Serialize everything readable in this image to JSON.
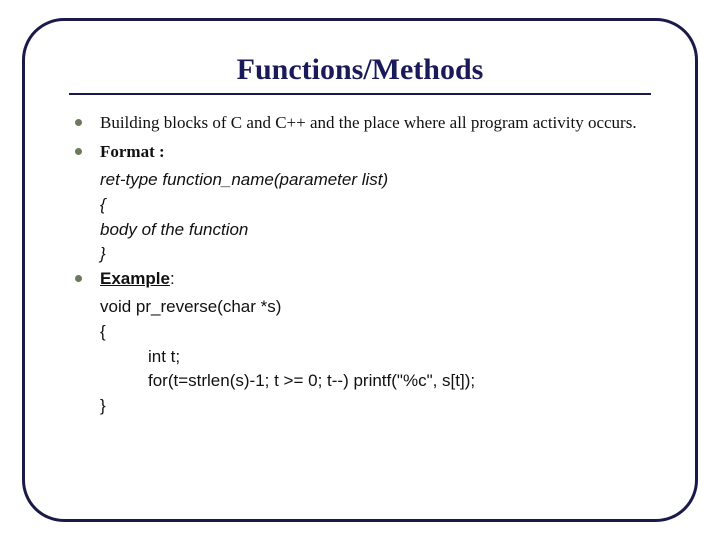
{
  "title": "Functions/Methods",
  "bullets": {
    "b1": "Building blocks of C and C++ and the place where all program activity occurs.",
    "b2": "Format :",
    "b3_label": "Example",
    "b3_suffix": ":"
  },
  "format_block": {
    "l1": "ret-type function_name(parameter list)",
    "l2": "{",
    "l3": "body of the function",
    "l4": "}"
  },
  "example_block": {
    "l1": "void pr_reverse(char *s)",
    "l2": "{",
    "l3": "int t;",
    "l4": "for(t=strlen(s)-1; t >= 0; t--) printf(\"%c\", s[t]);",
    "l5": "}"
  }
}
